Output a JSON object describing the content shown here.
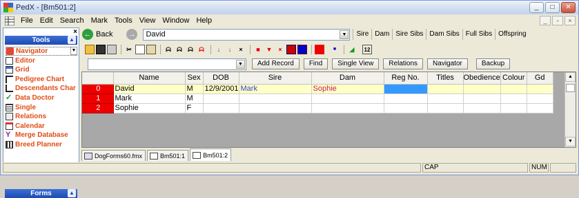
{
  "window": {
    "title": "PedX - [Bm501:2]"
  },
  "menu": [
    {
      "label": "File"
    },
    {
      "label": "Edit"
    },
    {
      "label": "Search"
    },
    {
      "label": "Mark"
    },
    {
      "label": "Tools"
    },
    {
      "label": "View"
    },
    {
      "label": "Window"
    },
    {
      "label": "Help"
    }
  ],
  "sidebar": {
    "tools_header": "Tools",
    "forms_header": "Forms",
    "items": [
      {
        "label": "Navigator",
        "icon": "navigator-icon",
        "color": "#e04d16"
      },
      {
        "label": "Editor",
        "icon": "editor-icon",
        "color": "#e04d16"
      },
      {
        "label": "Grid",
        "icon": "grid-icon",
        "color": "#e04d16"
      },
      {
        "label": "Pedigree Chart",
        "icon": "pedigree-icon",
        "color": "#e04d16"
      },
      {
        "label": "Descendants Char",
        "icon": "descendants-icon",
        "color": "#e04d16"
      },
      {
        "label": "Data Doctor",
        "icon": "check-icon",
        "color": "#e04d16"
      },
      {
        "label": "Single",
        "icon": "single-icon",
        "color": "#e04d16"
      },
      {
        "label": "Relations",
        "icon": "relations-icon",
        "color": "#e04d16"
      },
      {
        "label": "Calendar",
        "icon": "calendar-icon",
        "color": "#e04d16"
      },
      {
        "label": "Merge Database",
        "icon": "merge-icon",
        "color": "#e04d16"
      },
      {
        "label": "Breed Planner",
        "icon": "planner-icon",
        "color": "#e04d16"
      }
    ]
  },
  "nav": {
    "back_label": "Back",
    "current_dog": "David",
    "links": [
      "Sire",
      "Dam",
      "Sire Sibs",
      "Dam Sibs",
      "Full Sibs",
      "Offspring"
    ]
  },
  "actions": {
    "filter_value": "",
    "buttons": [
      "Add Record",
      "Find",
      "Single View",
      "Relations",
      "Navigator",
      "Backup"
    ]
  },
  "grid": {
    "columns": [
      "",
      "Name",
      "Sex",
      "DOB",
      "Sire",
      "Dam",
      "Reg No.",
      "Titles",
      "Obedience",
      "Colour",
      "Gd"
    ],
    "rows": [
      {
        "num": "0",
        "name": "David",
        "sex": "M",
        "dob": "12/9/2001",
        "sire": "Mark",
        "dam": "Sophie",
        "reg": "",
        "titles": "",
        "obedience": "",
        "colour": "",
        "gd": ""
      },
      {
        "num": "1",
        "name": "Mark",
        "sex": "M",
        "dob": "",
        "sire": "",
        "dam": "",
        "reg": "",
        "titles": "",
        "obedience": "",
        "colour": "",
        "gd": ""
      },
      {
        "num": "2",
        "name": "Sophie",
        "sex": "F",
        "dob": "",
        "sire": "",
        "dam": "",
        "reg": "",
        "titles": "",
        "obedience": "",
        "colour": "",
        "gd": ""
      }
    ]
  },
  "tabs": [
    {
      "label": "DogForms60.fmx"
    },
    {
      "label": "Bm501:1"
    },
    {
      "label": "Bm501:2"
    }
  ],
  "status": {
    "cap": "CAP",
    "num": "NUM"
  }
}
